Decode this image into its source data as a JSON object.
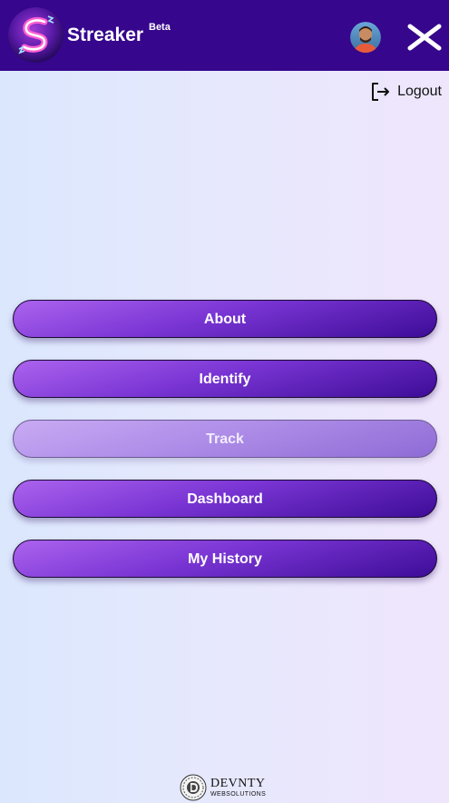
{
  "header": {
    "brand_name": "Streaker",
    "brand_badge": "Beta",
    "logo_icon": "streaker-s-logo-icon",
    "avatar_icon": "user-avatar",
    "close_icon": "close-x-icon",
    "background_color": "#36068d"
  },
  "logout": {
    "label": "Logout",
    "icon": "logout-icon"
  },
  "menu": {
    "items": [
      {
        "label": "About",
        "active": false
      },
      {
        "label": "Identify",
        "active": false
      },
      {
        "label": "Track",
        "active": true
      },
      {
        "label": "Dashboard",
        "active": false
      },
      {
        "label": "My History",
        "active": false
      }
    ],
    "accent_color": "#7a35d4"
  },
  "footer": {
    "title": "DEVNTY",
    "subtitle": "WEBSOLUTIONS",
    "icon": "devnty-logo-icon"
  }
}
